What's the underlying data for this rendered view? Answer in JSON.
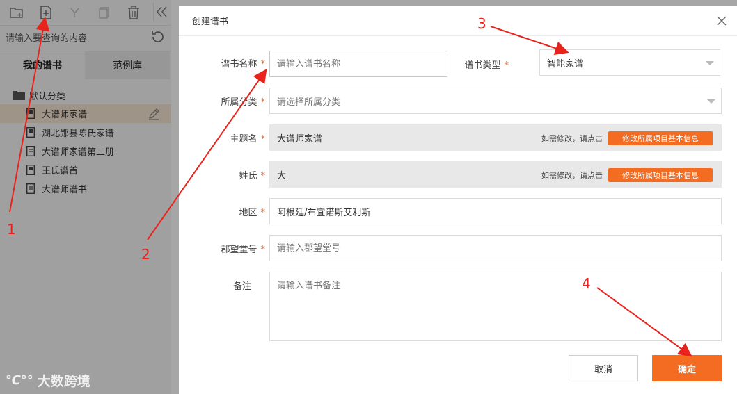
{
  "left_panel": {
    "search": {
      "placeholder": "请输入要查询的内容"
    },
    "tabs": [
      {
        "label": "我的谱书"
      },
      {
        "label": "范例库"
      }
    ],
    "folder": {
      "label": "默认分类"
    },
    "items": [
      {
        "label": "大谱师家谱"
      },
      {
        "label": "湖北郧县陈氏家谱"
      },
      {
        "label": "大谱师家谱第二册"
      },
      {
        "label": "王氏谱首"
      },
      {
        "label": "大谱师谱书"
      }
    ]
  },
  "dialog": {
    "title": "创建谱书",
    "fields": {
      "name": {
        "label": "谱书名称",
        "placeholder": "请输入谱书名称"
      },
      "type": {
        "label": "谱书类型",
        "value": "智能家谱"
      },
      "category": {
        "label": "所属分类",
        "placeholder": "请选择所属分类"
      },
      "theme": {
        "label": "主题名",
        "value": "大谱师家谱",
        "tip": "如需修改，请点击",
        "button": "修改所属项目基本信息"
      },
      "surname": {
        "label": "姓氏",
        "value": "大",
        "tip": "如需修改，请点击",
        "button": "修改所属项目基本信息"
      },
      "region": {
        "label": "地区",
        "value": "阿根廷/布宜诺斯艾利斯"
      },
      "hall": {
        "label": "郡望堂号",
        "placeholder": "请输入郡望堂号"
      },
      "remark": {
        "label": "备注",
        "placeholder": "请输入谱书备注"
      }
    },
    "required_mark": "*",
    "cancel_label": "取消",
    "confirm_label": "确定"
  },
  "annotations": {
    "n1": "1",
    "n2": "2",
    "n3": "3",
    "n4": "4"
  },
  "watermark": {
    "logo": "℃°°",
    "text": "大数跨境"
  },
  "colors": {
    "accent": "#f36c21",
    "annotation": "#e8231c",
    "required": "#f06a2a"
  }
}
